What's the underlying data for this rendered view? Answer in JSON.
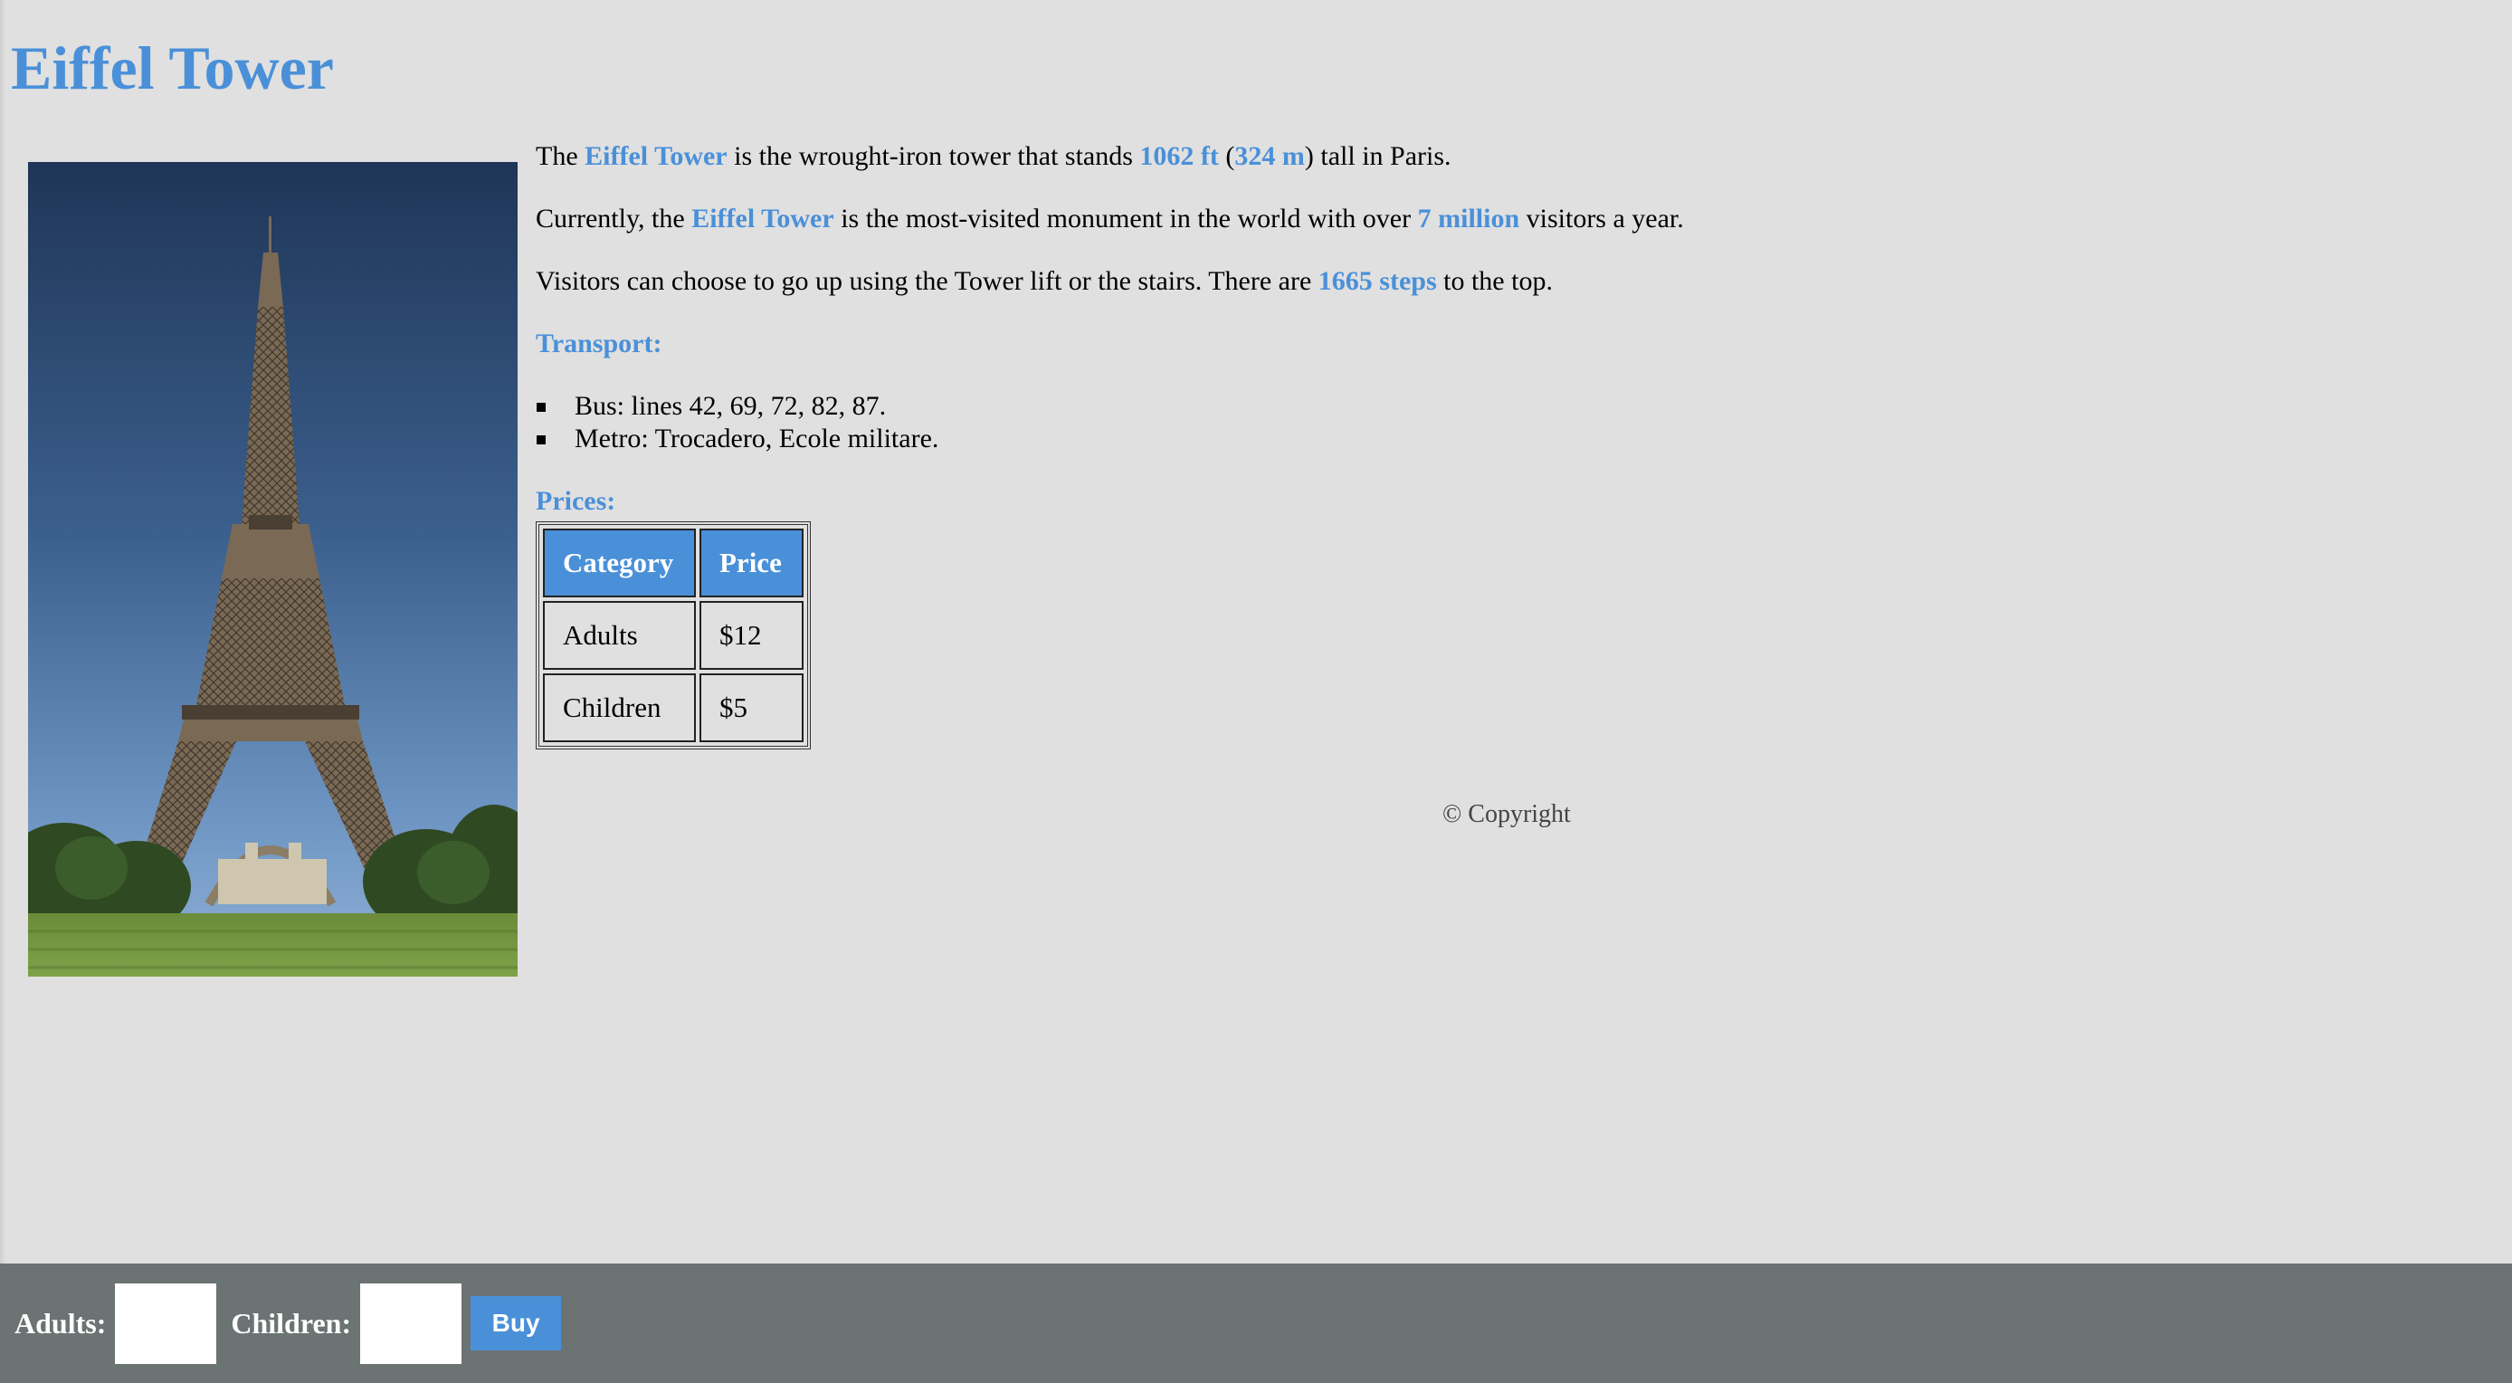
{
  "page": {
    "title": "Eiffel Tower"
  },
  "intro": {
    "p1": {
      "t1": "The ",
      "name": "Eiffel Tower",
      "t2": " is the wrought-iron tower that stands ",
      "height_ft": "1062 ft",
      "t3": " (",
      "height_m": "324 m",
      "t4": ") tall in Paris."
    },
    "p2": {
      "t1": "Currently, the ",
      "name": "Eiffel Tower",
      "t2": " is the most-visited monument in the world with over ",
      "visitors": "7 million",
      "t3": " visitors a year."
    },
    "p3": {
      "t1": "Visitors can choose to go up using the Tower lift or the stairs. There are ",
      "steps": "1665 steps",
      "t2": " to the top."
    }
  },
  "transport": {
    "heading": "Transport:",
    "items": [
      "Bus: lines 42, 69, 72, 82, 87.",
      "Metro: Trocadero, Ecole militare."
    ]
  },
  "prices": {
    "heading": "Prices:",
    "columns": [
      "Category",
      "Price"
    ],
    "rows": [
      [
        "Adults",
        "$12"
      ],
      [
        "Children",
        "$5"
      ]
    ]
  },
  "footer": {
    "copyright": "© Copyright"
  },
  "purchase_bar": {
    "adults_label": "Adults:",
    "adults_value": "",
    "children_label": "Children:",
    "children_value": "",
    "buy_label": "Buy"
  },
  "colors": {
    "accent": "#4a90d9",
    "background": "#e0e0e0",
    "bar": "#6b7373"
  }
}
